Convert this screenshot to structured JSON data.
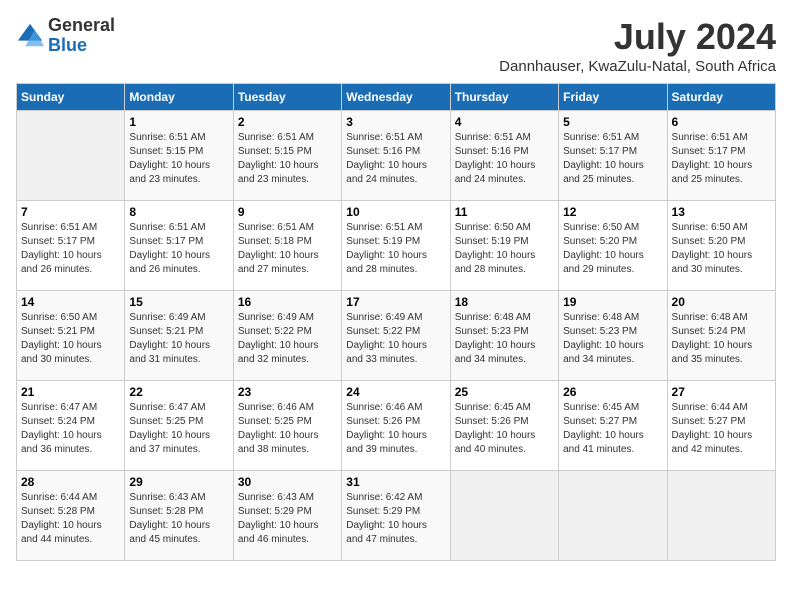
{
  "logo": {
    "general": "General",
    "blue": "Blue"
  },
  "title": "July 2024",
  "subtitle": "Dannhauser, KwaZulu-Natal, South Africa",
  "headers": [
    "Sunday",
    "Monday",
    "Tuesday",
    "Wednesday",
    "Thursday",
    "Friday",
    "Saturday"
  ],
  "weeks": [
    [
      {
        "day": "",
        "info": ""
      },
      {
        "day": "1",
        "info": "Sunrise: 6:51 AM\nSunset: 5:15 PM\nDaylight: 10 hours\nand 23 minutes."
      },
      {
        "day": "2",
        "info": "Sunrise: 6:51 AM\nSunset: 5:15 PM\nDaylight: 10 hours\nand 23 minutes."
      },
      {
        "day": "3",
        "info": "Sunrise: 6:51 AM\nSunset: 5:16 PM\nDaylight: 10 hours\nand 24 minutes."
      },
      {
        "day": "4",
        "info": "Sunrise: 6:51 AM\nSunset: 5:16 PM\nDaylight: 10 hours\nand 24 minutes."
      },
      {
        "day": "5",
        "info": "Sunrise: 6:51 AM\nSunset: 5:17 PM\nDaylight: 10 hours\nand 25 minutes."
      },
      {
        "day": "6",
        "info": "Sunrise: 6:51 AM\nSunset: 5:17 PM\nDaylight: 10 hours\nand 25 minutes."
      }
    ],
    [
      {
        "day": "7",
        "info": ""
      },
      {
        "day": "8",
        "info": "Sunrise: 6:51 AM\nSunset: 5:17 PM\nDaylight: 10 hours\nand 26 minutes."
      },
      {
        "day": "9",
        "info": "Sunrise: 6:51 AM\nSunset: 5:18 PM\nDaylight: 10 hours\nand 27 minutes."
      },
      {
        "day": "10",
        "info": "Sunrise: 6:51 AM\nSunset: 5:19 PM\nDaylight: 10 hours\nand 28 minutes."
      },
      {
        "day": "11",
        "info": "Sunrise: 6:50 AM\nSunset: 5:19 PM\nDaylight: 10 hours\nand 28 minutes."
      },
      {
        "day": "12",
        "info": "Sunrise: 6:50 AM\nSunset: 5:20 PM\nDaylight: 10 hours\nand 29 minutes."
      },
      {
        "day": "13",
        "info": "Sunrise: 6:50 AM\nSunset: 5:20 PM\nDaylight: 10 hours\nand 30 minutes."
      }
    ],
    [
      {
        "day": "14",
        "info": ""
      },
      {
        "day": "15",
        "info": "Sunrise: 6:49 AM\nSunset: 5:21 PM\nDaylight: 10 hours\nand 31 minutes."
      },
      {
        "day": "16",
        "info": "Sunrise: 6:49 AM\nSunset: 5:22 PM\nDaylight: 10 hours\nand 32 minutes."
      },
      {
        "day": "17",
        "info": "Sunrise: 6:49 AM\nSunset: 5:22 PM\nDaylight: 10 hours\nand 33 minutes."
      },
      {
        "day": "18",
        "info": "Sunrise: 6:48 AM\nSunset: 5:23 PM\nDaylight: 10 hours\nand 34 minutes."
      },
      {
        "day": "19",
        "info": "Sunrise: 6:48 AM\nSunset: 5:23 PM\nDaylight: 10 hours\nand 34 minutes."
      },
      {
        "day": "20",
        "info": "Sunrise: 6:48 AM\nSunset: 5:24 PM\nDaylight: 10 hours\nand 35 minutes."
      }
    ],
    [
      {
        "day": "21",
        "info": ""
      },
      {
        "day": "22",
        "info": "Sunrise: 6:47 AM\nSunset: 5:25 PM\nDaylight: 10 hours\nand 37 minutes."
      },
      {
        "day": "23",
        "info": "Sunrise: 6:46 AM\nSunset: 5:25 PM\nDaylight: 10 hours\nand 38 minutes."
      },
      {
        "day": "24",
        "info": "Sunrise: 6:46 AM\nSunset: 5:26 PM\nDaylight: 10 hours\nand 39 minutes."
      },
      {
        "day": "25",
        "info": "Sunrise: 6:45 AM\nSunset: 5:26 PM\nDaylight: 10 hours\nand 40 minutes."
      },
      {
        "day": "26",
        "info": "Sunrise: 6:45 AM\nSunset: 5:27 PM\nDaylight: 10 hours\nand 41 minutes."
      },
      {
        "day": "27",
        "info": "Sunrise: 6:44 AM\nSunset: 5:27 PM\nDaylight: 10 hours\nand 42 minutes."
      }
    ],
    [
      {
        "day": "28",
        "info": "Sunrise: 6:44 AM\nSunset: 5:28 PM\nDaylight: 10 hours\nand 44 minutes."
      },
      {
        "day": "29",
        "info": "Sunrise: 6:43 AM\nSunset: 5:28 PM\nDaylight: 10 hours\nand 45 minutes."
      },
      {
        "day": "30",
        "info": "Sunrise: 6:43 AM\nSunset: 5:29 PM\nDaylight: 10 hours\nand 46 minutes."
      },
      {
        "day": "31",
        "info": "Sunrise: 6:42 AM\nSunset: 5:29 PM\nDaylight: 10 hours\nand 47 minutes."
      },
      {
        "day": "",
        "info": ""
      },
      {
        "day": "",
        "info": ""
      },
      {
        "day": "",
        "info": ""
      }
    ]
  ],
  "week1_day7_info": "Sunrise: 6:51 AM\nSunset: 5:17 PM\nDaylight: 10 hours\nand 26 minutes.",
  "week2_day14_info": "Sunrise: 6:50 AM\nSunset: 5:21 PM\nDaylight: 10 hours\nand 30 minutes.",
  "week3_day21_info": "Sunrise: 6:47 AM\nSunset: 5:24 PM\nDaylight: 10 hours\nand 36 minutes."
}
